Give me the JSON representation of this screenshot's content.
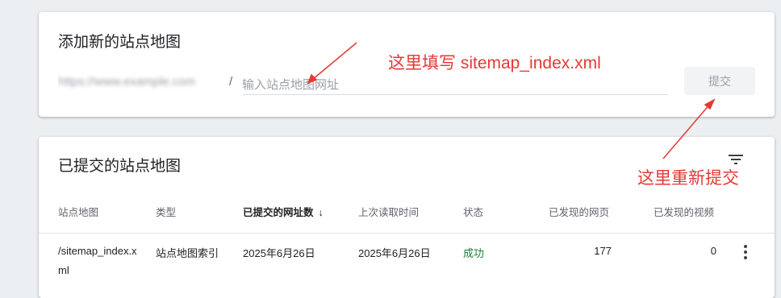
{
  "add_sitemap": {
    "title": "添加新的站点地图",
    "url_prefix": "https://www.example.com",
    "url_slash": "/",
    "input_placeholder": "输入站点地图网址",
    "input_value": "",
    "submit_label": "提交"
  },
  "submitted_sitemaps": {
    "title": "已提交的站点地图",
    "filter_icon": "filter-icon",
    "columns": [
      "站点地图",
      "类型",
      "已提交的网址数",
      "上次读取时间",
      "状态",
      "已发现的网页",
      "已发现的视频"
    ],
    "sorted_column_arrow": "↓",
    "rows": [
      {
        "sitemap": "/sitemap_index.xml",
        "type": "站点地图索引",
        "submitted": "2025年6月26日",
        "last_read": "2025年6月26日",
        "status": "成功",
        "pages": "177",
        "videos": "0"
      }
    ],
    "row_menu_icon": "more-vert-icon"
  },
  "annotations": {
    "fill_here": "这里填写 sitemap_index.xml",
    "resubmit_here": "这里重新提交",
    "color": "#e53935"
  }
}
